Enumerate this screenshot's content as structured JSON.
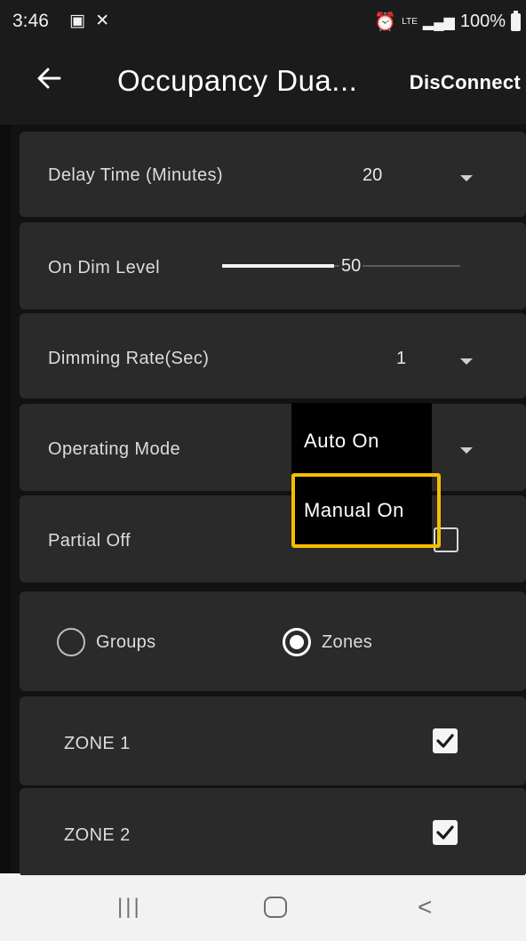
{
  "status_bar": {
    "time": "3:46",
    "left_icons": "gallery-icon, missed-call-icon",
    "right_icons": "alarm-icon, lte-icon, signal-icon",
    "lte_text": "LTE",
    "battery": "100%"
  },
  "app_bar": {
    "back_icon": "arrow-left-icon",
    "title": "Occupancy Dua...",
    "disconnect_label": "DisConnect"
  },
  "settings": {
    "delay_time": {
      "label": "Delay Time (Minutes)",
      "value": "20"
    },
    "on_dim_level": {
      "label": "On Dim Level",
      "value": "50",
      "fraction": 0.47
    },
    "dimming_rate": {
      "label": "Dimming Rate(Sec)",
      "value": "1"
    },
    "operating_mode": {
      "label": "Operating Mode"
    },
    "partial_off": {
      "label": "Partial Off",
      "checked": false
    }
  },
  "grouping": {
    "groups_label": "Groups",
    "zones_label": "Zones",
    "selected": "Zones"
  },
  "zones": [
    {
      "label": "ZONE 1",
      "checked": true
    },
    {
      "label": "ZONE 2",
      "checked": true
    }
  ],
  "dropdown": {
    "options": [
      "Auto On",
      "Manual On"
    ],
    "highlighted": "Manual On",
    "highlight_color": "#f6be00"
  },
  "nav_bar": {
    "recents_glyph": "|||",
    "back_glyph": "<"
  }
}
